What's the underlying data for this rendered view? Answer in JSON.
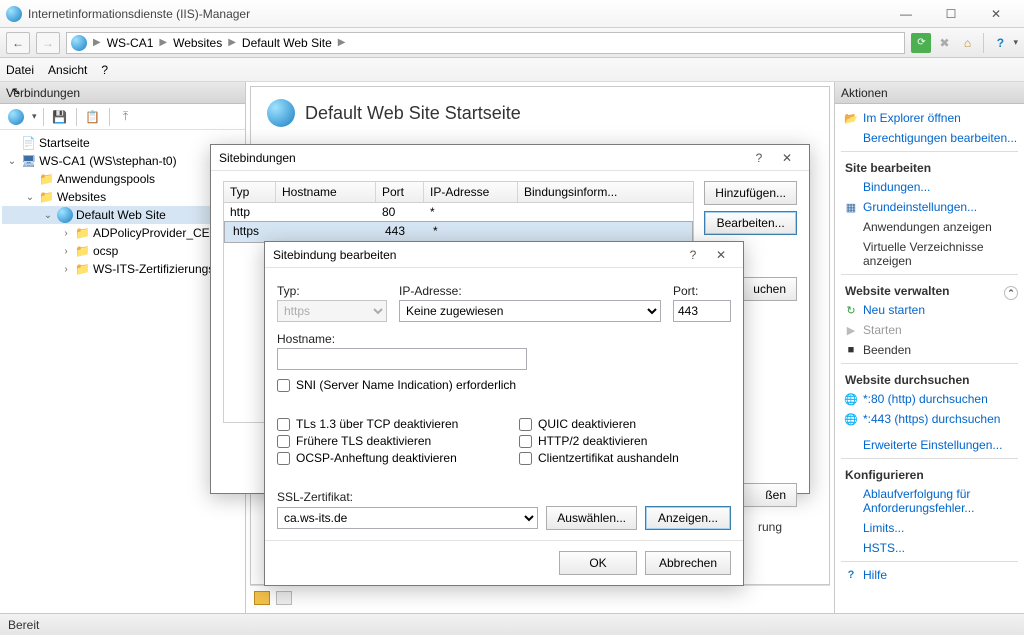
{
  "window": {
    "title": "Internetinformationsdienste (IIS)-Manager"
  },
  "breadcrumb": [
    "WS-CA1",
    "Websites",
    "Default Web Site"
  ],
  "menus": {
    "file": "Datei",
    "view": "Ansicht",
    "help": "?"
  },
  "connections": {
    "title": "Verbindungen",
    "tree": {
      "start": "Startseite",
      "server": "WS-CA1 (WS\\stephan-t0)",
      "apppools": "Anwendungspools",
      "sites": "Websites",
      "defaultSite": "Default Web Site",
      "children": [
        "ADPolicyProvider_CEP",
        "ocsp",
        "WS-ITS-Zertifizierungs"
      ]
    }
  },
  "center": {
    "title": "Default Web Site Startseite",
    "truncated": "rung",
    "closeWord": "ßen"
  },
  "actions": {
    "title": "Aktionen",
    "openExplorer": "Im Explorer öffnen",
    "editPerms": "Berechtigungen bearbeiten...",
    "sectSite": "Site bearbeiten",
    "bindings": "Bindungen...",
    "basic": "Grundeinstellungen...",
    "viewApps": "Anwendungen anzeigen",
    "viewVdirs": "Virtuelle Verzeichnisse anzeigen",
    "sectManage": "Website verwalten",
    "restart": "Neu starten",
    "start": "Starten",
    "stop": "Beenden",
    "sectBrowse": "Website durchsuchen",
    "browse80": "*:80 (http) durchsuchen",
    "browse443": "*:443 (https) durchsuchen",
    "advanced": "Erweiterte Einstellungen...",
    "sectConfig": "Konfigurieren",
    "tracing": "Ablaufverfolgung für Anforderungsfehler...",
    "limits": "Limits...",
    "hsts": "HSTS...",
    "help": "Hilfe"
  },
  "bindingsDialog": {
    "title": "Sitebindungen",
    "headers": {
      "type": "Typ",
      "host": "Hostname",
      "port": "Port",
      "ip": "IP-Adresse",
      "info": "Bindungsinform..."
    },
    "rows": [
      {
        "type": "http",
        "host": "",
        "port": "80",
        "ip": "*"
      },
      {
        "type": "https",
        "host": "",
        "port": "443",
        "ip": "*"
      }
    ],
    "add": "Hinzufügen...",
    "edit": "Bearbeiten...",
    "browse": "uchen"
  },
  "editDialog": {
    "title": "Sitebindung bearbeiten",
    "type": "Typ:",
    "typeVal": "https",
    "ip": "IP-Adresse:",
    "ipVal": "Keine zugewiesen",
    "port": "Port:",
    "portVal": "443",
    "host": "Hostname:",
    "hostVal": "",
    "sni": "SNI (Server Name Indication) erforderlich",
    "tls13": "TLs 1.3 über TCP deaktivieren",
    "legacyTls": "Frühere TLS deaktivieren",
    "ocsp": "OCSP-Anheftung deaktivieren",
    "quic": "QUIC deaktivieren",
    "http2": "HTTP/2 deaktivieren",
    "clientcert": "Clientzertifikat aushandeln",
    "sslCert": "SSL-Zertifikat:",
    "sslCertVal": "ca.ws-its.de",
    "select": "Auswählen...",
    "view": "Anzeigen...",
    "ok": "OK",
    "cancel": "Abbrechen"
  },
  "status": "Bereit"
}
